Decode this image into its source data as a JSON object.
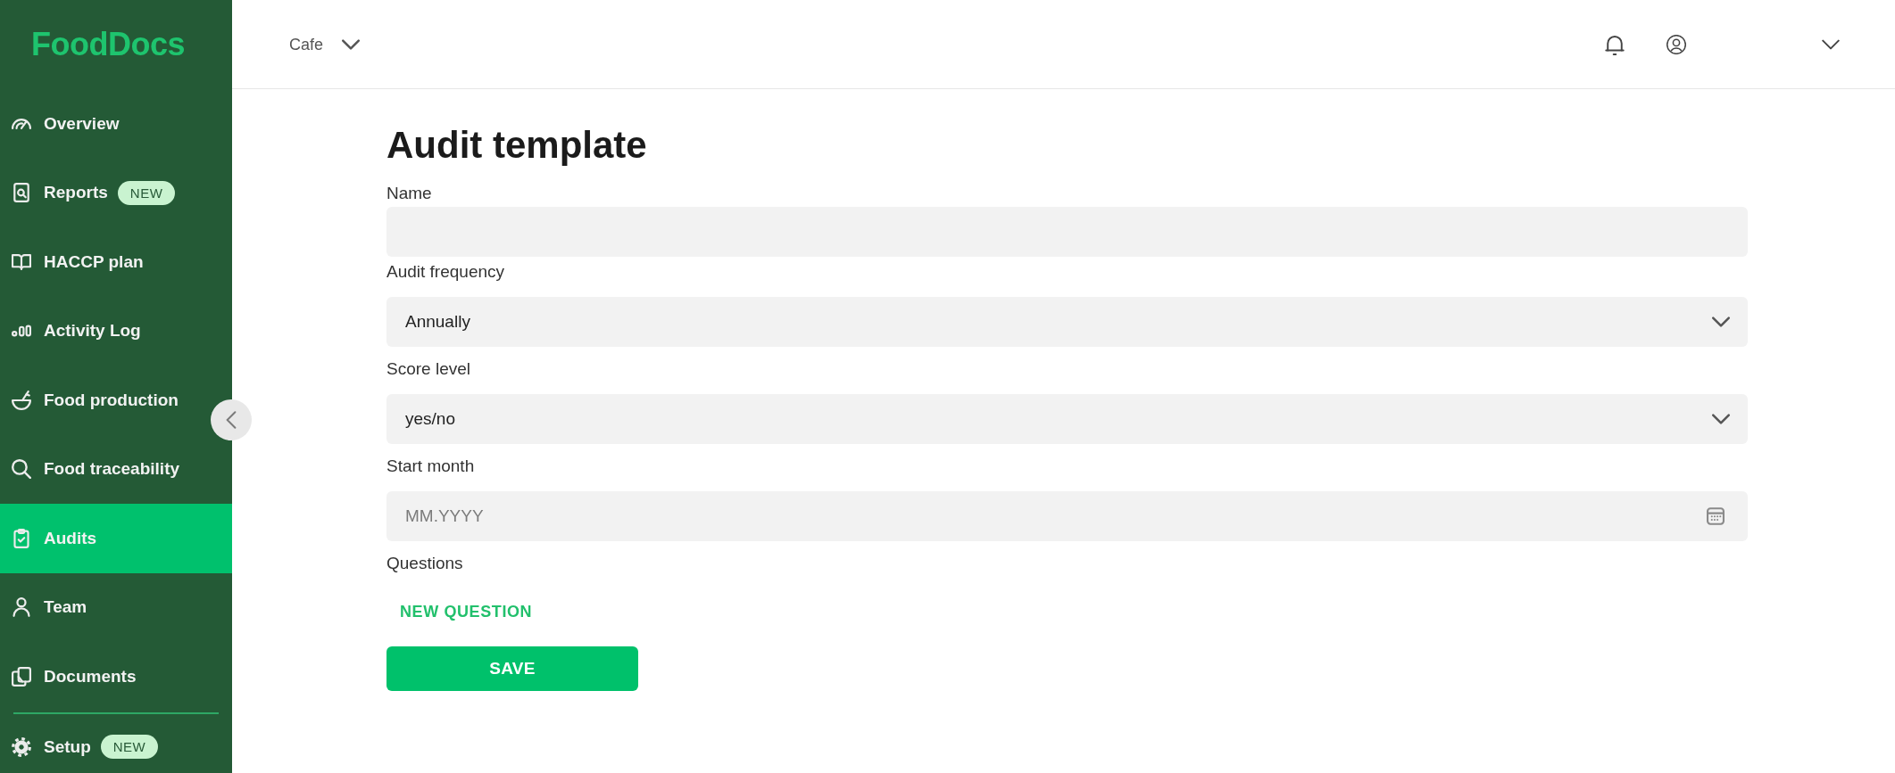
{
  "sidebar": {
    "logo": "FoodDocs",
    "items": [
      {
        "label": "Overview",
        "selected": false
      },
      {
        "label": "Reports",
        "badge": "NEW",
        "selected": false
      },
      {
        "label": "HACCP plan",
        "selected": false
      },
      {
        "label": "Activity Log",
        "selected": false
      },
      {
        "label": "Food production",
        "selected": false
      },
      {
        "label": "Food traceability",
        "selected": false
      },
      {
        "label": "Audits",
        "selected": true
      },
      {
        "label": "Team",
        "selected": false
      },
      {
        "label": "Documents",
        "selected": false
      }
    ],
    "footer_items": [
      {
        "label": "Setup",
        "badge": "NEW",
        "selected": false
      }
    ]
  },
  "header": {
    "location": "Cafe"
  },
  "page": {
    "title": "Audit template",
    "fields": [
      {
        "kind": "text",
        "label": "Name"
      },
      {
        "kind": "select",
        "label": "Audit frequency",
        "value": "Annually"
      },
      {
        "kind": "select",
        "label": "Score level",
        "value": "yes/no"
      },
      {
        "kind": "date",
        "label": "Start month",
        "placeholder": "MM.YYYY"
      }
    ],
    "questions": {
      "label": "Questions",
      "add_button": "NEW QUESTION"
    },
    "save_button": "SAVE"
  }
}
